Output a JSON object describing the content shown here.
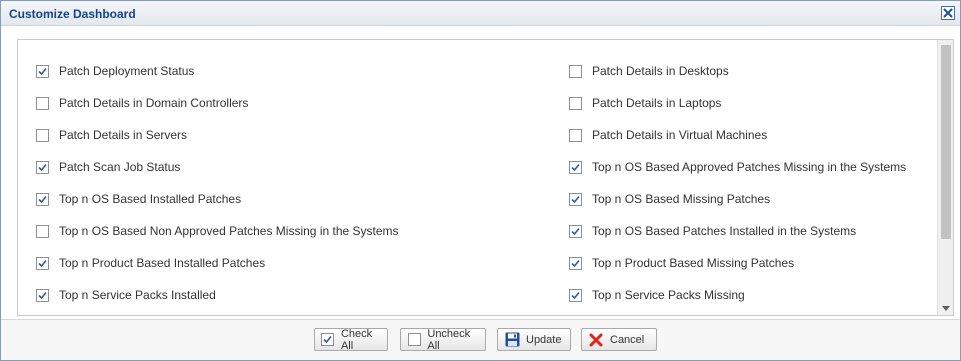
{
  "dialog": {
    "title": "Customize Dashboard",
    "close_icon": "close-icon"
  },
  "items_left": [
    {
      "label": "Patch Deployment Status",
      "checked": true
    },
    {
      "label": "Patch Details in Domain Controllers",
      "checked": false
    },
    {
      "label": "Patch Details in Servers",
      "checked": false
    },
    {
      "label": "Patch Scan Job Status",
      "checked": true
    },
    {
      "label": "Top n OS Based Installed Patches",
      "checked": true
    },
    {
      "label": "Top n OS Based Non Approved Patches Missing in the Systems",
      "checked": false
    },
    {
      "label": "Top n Product Based Installed Patches",
      "checked": true
    },
    {
      "label": "Top n Service Packs Installed",
      "checked": true
    }
  ],
  "items_right": [
    {
      "label": "Patch Details in Desktops",
      "checked": false
    },
    {
      "label": "Patch Details in Laptops",
      "checked": false
    },
    {
      "label": "Patch Details in Virtual Machines",
      "checked": false
    },
    {
      "label": "Top n OS Based Approved Patches Missing in the Systems",
      "checked": true
    },
    {
      "label": "Top n OS Based Missing Patches",
      "checked": true
    },
    {
      "label": "Top n OS Based Patches Installed in the Systems",
      "checked": true
    },
    {
      "label": "Top n Product Based Missing Patches",
      "checked": true
    },
    {
      "label": "Top n Service Packs Missing",
      "checked": true
    }
  ],
  "footer": {
    "check_all_label": "Check All",
    "uncheck_all_label": "Uncheck All",
    "update_label": "Update",
    "cancel_label": "Cancel"
  },
  "colors": {
    "title_text": "#15428b",
    "check_mark": "#3a5f8c",
    "cancel_icon": "#e0241b",
    "update_icon": "#1f4e9c"
  },
  "icons": {
    "update": "floppy-disk-icon",
    "cancel": "red-x-icon",
    "scroll_up": "arrow-up-icon",
    "scroll_down": "arrow-down-icon"
  }
}
